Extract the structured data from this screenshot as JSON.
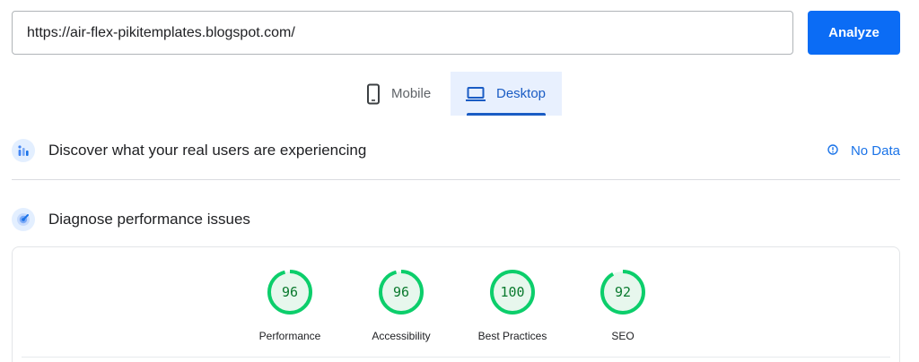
{
  "search": {
    "url_value": "https://air-flex-pikitemplates.blogspot.com/",
    "analyze_label": "Analyze"
  },
  "tabs": [
    {
      "label": "Mobile",
      "icon": "phone-icon",
      "selected": false
    },
    {
      "label": "Desktop",
      "icon": "laptop-icon",
      "selected": true
    }
  ],
  "field_data": {
    "title": "Discover what your real users are experiencing",
    "status": "No Data",
    "icon": "users-chart-icon",
    "status_icon": "info-icon"
  },
  "lab_data": {
    "title": "Diagnose performance issues",
    "icon": "lighthouse-icon"
  },
  "scores": [
    {
      "label": "Performance",
      "value": 96
    },
    {
      "label": "Accessibility",
      "value": 96
    },
    {
      "label": "Best Practices",
      "value": 100
    },
    {
      "label": "SEO",
      "value": 92
    }
  ],
  "colors": {
    "accent": "#0b6cf5",
    "selected_tab_bg": "#e8f0fe",
    "selected_tab_text": "#1a5cc4",
    "pass_green": "#0cce6b",
    "pass_text": "#0a7a2e",
    "pass_fill": "#e7f7ed",
    "link_blue": "#1a73e8"
  }
}
